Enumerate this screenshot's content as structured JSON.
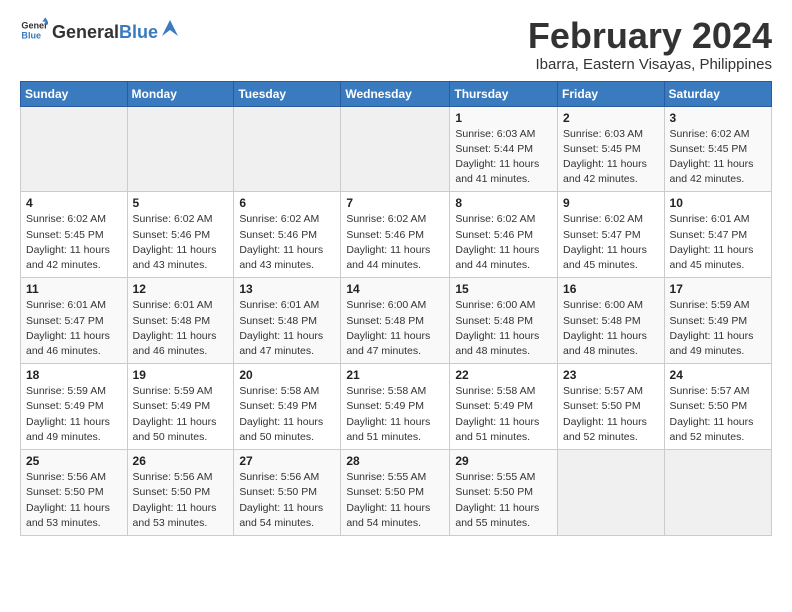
{
  "logo": {
    "text_general": "General",
    "text_blue": "Blue"
  },
  "title": "February 2024",
  "location": "Ibarra, Eastern Visayas, Philippines",
  "days_of_week": [
    "Sunday",
    "Monday",
    "Tuesday",
    "Wednesday",
    "Thursday",
    "Friday",
    "Saturday"
  ],
  "weeks": [
    [
      {
        "day": "",
        "info": ""
      },
      {
        "day": "",
        "info": ""
      },
      {
        "day": "",
        "info": ""
      },
      {
        "day": "",
        "info": ""
      },
      {
        "day": "1",
        "info": "Sunrise: 6:03 AM\nSunset: 5:44 PM\nDaylight: 11 hours and 41 minutes."
      },
      {
        "day": "2",
        "info": "Sunrise: 6:03 AM\nSunset: 5:45 PM\nDaylight: 11 hours and 42 minutes."
      },
      {
        "day": "3",
        "info": "Sunrise: 6:02 AM\nSunset: 5:45 PM\nDaylight: 11 hours and 42 minutes."
      }
    ],
    [
      {
        "day": "4",
        "info": "Sunrise: 6:02 AM\nSunset: 5:45 PM\nDaylight: 11 hours and 42 minutes."
      },
      {
        "day": "5",
        "info": "Sunrise: 6:02 AM\nSunset: 5:46 PM\nDaylight: 11 hours and 43 minutes."
      },
      {
        "day": "6",
        "info": "Sunrise: 6:02 AM\nSunset: 5:46 PM\nDaylight: 11 hours and 43 minutes."
      },
      {
        "day": "7",
        "info": "Sunrise: 6:02 AM\nSunset: 5:46 PM\nDaylight: 11 hours and 44 minutes."
      },
      {
        "day": "8",
        "info": "Sunrise: 6:02 AM\nSunset: 5:46 PM\nDaylight: 11 hours and 44 minutes."
      },
      {
        "day": "9",
        "info": "Sunrise: 6:02 AM\nSunset: 5:47 PM\nDaylight: 11 hours and 45 minutes."
      },
      {
        "day": "10",
        "info": "Sunrise: 6:01 AM\nSunset: 5:47 PM\nDaylight: 11 hours and 45 minutes."
      }
    ],
    [
      {
        "day": "11",
        "info": "Sunrise: 6:01 AM\nSunset: 5:47 PM\nDaylight: 11 hours and 46 minutes."
      },
      {
        "day": "12",
        "info": "Sunrise: 6:01 AM\nSunset: 5:48 PM\nDaylight: 11 hours and 46 minutes."
      },
      {
        "day": "13",
        "info": "Sunrise: 6:01 AM\nSunset: 5:48 PM\nDaylight: 11 hours and 47 minutes."
      },
      {
        "day": "14",
        "info": "Sunrise: 6:00 AM\nSunset: 5:48 PM\nDaylight: 11 hours and 47 minutes."
      },
      {
        "day": "15",
        "info": "Sunrise: 6:00 AM\nSunset: 5:48 PM\nDaylight: 11 hours and 48 minutes."
      },
      {
        "day": "16",
        "info": "Sunrise: 6:00 AM\nSunset: 5:48 PM\nDaylight: 11 hours and 48 minutes."
      },
      {
        "day": "17",
        "info": "Sunrise: 5:59 AM\nSunset: 5:49 PM\nDaylight: 11 hours and 49 minutes."
      }
    ],
    [
      {
        "day": "18",
        "info": "Sunrise: 5:59 AM\nSunset: 5:49 PM\nDaylight: 11 hours and 49 minutes."
      },
      {
        "day": "19",
        "info": "Sunrise: 5:59 AM\nSunset: 5:49 PM\nDaylight: 11 hours and 50 minutes."
      },
      {
        "day": "20",
        "info": "Sunrise: 5:58 AM\nSunset: 5:49 PM\nDaylight: 11 hours and 50 minutes."
      },
      {
        "day": "21",
        "info": "Sunrise: 5:58 AM\nSunset: 5:49 PM\nDaylight: 11 hours and 51 minutes."
      },
      {
        "day": "22",
        "info": "Sunrise: 5:58 AM\nSunset: 5:49 PM\nDaylight: 11 hours and 51 minutes."
      },
      {
        "day": "23",
        "info": "Sunrise: 5:57 AM\nSunset: 5:50 PM\nDaylight: 11 hours and 52 minutes."
      },
      {
        "day": "24",
        "info": "Sunrise: 5:57 AM\nSunset: 5:50 PM\nDaylight: 11 hours and 52 minutes."
      }
    ],
    [
      {
        "day": "25",
        "info": "Sunrise: 5:56 AM\nSunset: 5:50 PM\nDaylight: 11 hours and 53 minutes."
      },
      {
        "day": "26",
        "info": "Sunrise: 5:56 AM\nSunset: 5:50 PM\nDaylight: 11 hours and 53 minutes."
      },
      {
        "day": "27",
        "info": "Sunrise: 5:56 AM\nSunset: 5:50 PM\nDaylight: 11 hours and 54 minutes."
      },
      {
        "day": "28",
        "info": "Sunrise: 5:55 AM\nSunset: 5:50 PM\nDaylight: 11 hours and 54 minutes."
      },
      {
        "day": "29",
        "info": "Sunrise: 5:55 AM\nSunset: 5:50 PM\nDaylight: 11 hours and 55 minutes."
      },
      {
        "day": "",
        "info": ""
      },
      {
        "day": "",
        "info": ""
      }
    ]
  ]
}
